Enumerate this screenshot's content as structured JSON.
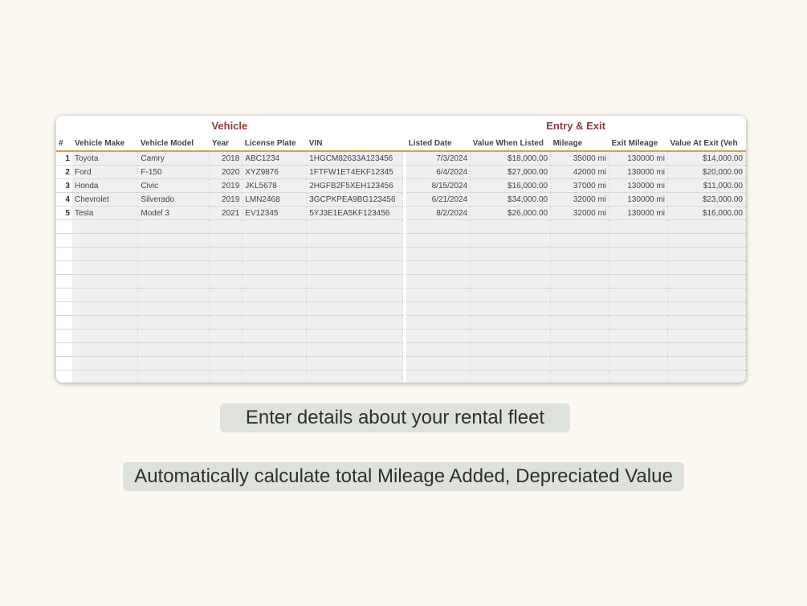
{
  "sheet": {
    "groups": {
      "vehicle": "Vehicle",
      "entry_exit": "Entry & Exit"
    },
    "columns": [
      "#",
      "Vehicle Make",
      "Vehicle Model",
      "Year",
      "License Plate",
      "VIN",
      "Listed Date",
      "Value When Listed",
      "Mileage",
      "Exit Mileage",
      "Value At Exit (Veh"
    ],
    "rows": [
      [
        "1",
        "Toyota",
        "Camry",
        "2018",
        "ABC1234",
        "1HGCM82633A123456",
        "7/3/2024",
        "$18,000.00",
        "35000 mi",
        "130000 mi",
        "$14,000.00"
      ],
      [
        "2",
        "Ford",
        "F-150",
        "2020",
        "XYZ9876",
        "1FTFW1ET4EKF12345",
        "6/4/2024",
        "$27,000.00",
        "42000 mi",
        "130000 mi",
        "$20,000.00"
      ],
      [
        "3",
        "Honda",
        "Civic",
        "2019",
        "JKL5678",
        "2HGFB2F5XEH123456",
        "8/15/2024",
        "$16,000.00",
        "37000 mi",
        "130000 mi",
        "$11,000.00"
      ],
      [
        "4",
        "Chevrolet",
        "Silverado",
        "2019",
        "LMN2468",
        "3GCPKPEA9BG123456",
        "6/21/2024",
        "$34,000.00",
        "32000 mi",
        "130000 mi",
        "$23,000.00"
      ],
      [
        "5",
        "Tesla",
        "Model 3",
        "2021",
        "EV12345",
        "5YJ3E1EA5KF123456",
        "8/2/2024",
        "$26,000.00",
        "32000 mi",
        "130000 mi",
        "$16,000.00"
      ]
    ],
    "accent_color": "#d4a24c",
    "title_color": "#8b3e3e"
  },
  "captions": {
    "first": "Enter details about your rental fleet",
    "second": "Automatically calculate total Mileage Added, Depreciated Value"
  }
}
